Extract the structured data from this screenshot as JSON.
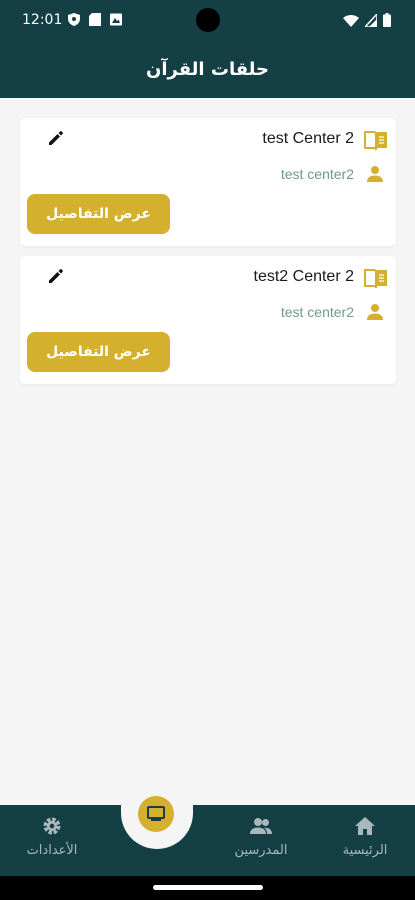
{
  "status_bar": {
    "time": "12:01",
    "icons_left": [
      "shield-icon",
      "sim-card-icon",
      "photo-icon"
    ],
    "icons_right": [
      "wifi-icon",
      "signal-icon",
      "battery-icon"
    ]
  },
  "app_bar": {
    "title": "حلقات القرآن"
  },
  "cards": [
    {
      "title": "test Center 2",
      "subtitle": "test center2",
      "button_label": "عرض التفاصيل"
    },
    {
      "title": "test2 Center 2",
      "subtitle": "test center2",
      "button_label": "عرض التفاصيل"
    }
  ],
  "bottom_nav": {
    "home": "الرئيسية",
    "teachers": "المدرسين",
    "settings": "الأعدادات"
  },
  "colors": {
    "primary_dark": "#143f45",
    "accent_gold": "#d4b02e",
    "subtitle_green": "#6f9a8d",
    "background": "#f5f5f5"
  }
}
